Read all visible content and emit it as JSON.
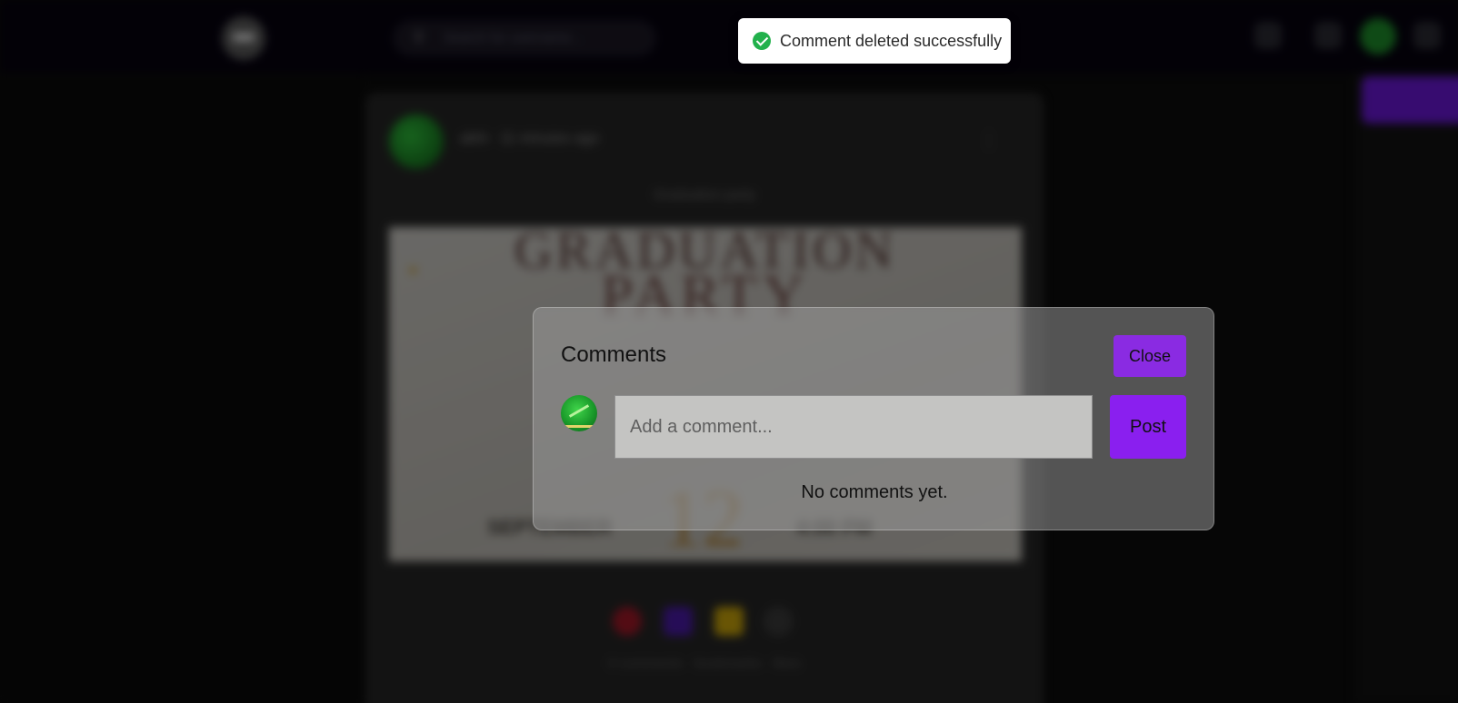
{
  "background": {
    "search_placeholder": "Search for username...",
    "post": {
      "author": "abhi · 11 minutes ago",
      "caption": "Graduation party",
      "poster_line1": "GRADUATION",
      "poster_line2": "PARTY",
      "poster_month": "SEPTEMBER",
      "poster_day": "12",
      "poster_time": "4:00 PM",
      "footer": "0 comments · bookmarks · likes"
    }
  },
  "toast": {
    "message": "Comment deleted successfully",
    "status_color": "#22b14c"
  },
  "comments_modal": {
    "title": "Comments",
    "close_label": "Close",
    "input": {
      "placeholder": "Add a comment...",
      "value": ""
    },
    "post_label": "Post",
    "empty_message": "No comments yet.",
    "accent_color": "#8a2be2"
  }
}
